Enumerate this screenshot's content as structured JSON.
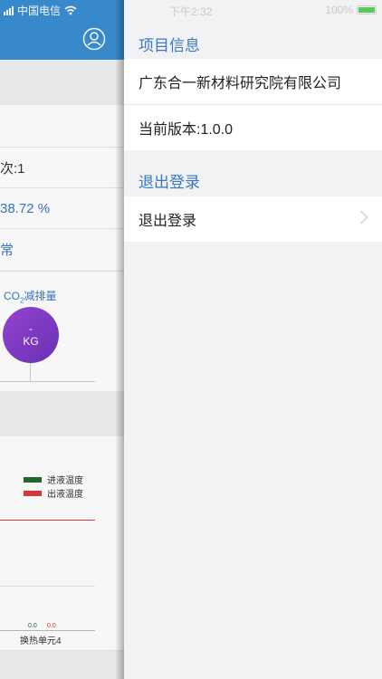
{
  "status_bar": {
    "carrier": "中国电信",
    "time": "下午2:32",
    "battery": "100%"
  },
  "background_app": {
    "row1_value": "次:1",
    "row2_value": "38.72 %",
    "row3_value": "常",
    "co2": {
      "label_prefix": "CO",
      "label_sub": "2",
      "label_suffix": "减排量",
      "value": "-",
      "unit": "KG"
    },
    "chart": {
      "legend": [
        {
          "name": "进液温度",
          "color": "#1f6b2a"
        },
        {
          "name": "出液温度",
          "color": "#d93b3b"
        }
      ],
      "values": [
        {
          "text": "0.0",
          "color": "#1f6b2a"
        },
        {
          "text": "0.0",
          "color": "#d93b3b"
        }
      ],
      "x_label": "换热单元4"
    }
  },
  "panel": {
    "project_section": {
      "title": "项目信息",
      "company": "广东合一新材料研究院有限公司",
      "version": "当前版本:1.0.0"
    },
    "logout_section": {
      "title": "退出登录",
      "button_label": "退出登录"
    }
  },
  "colors": {
    "accent": "#3a78c2",
    "header_blue": "#3a8ed2",
    "co2_purple": "#8a3fd0"
  }
}
